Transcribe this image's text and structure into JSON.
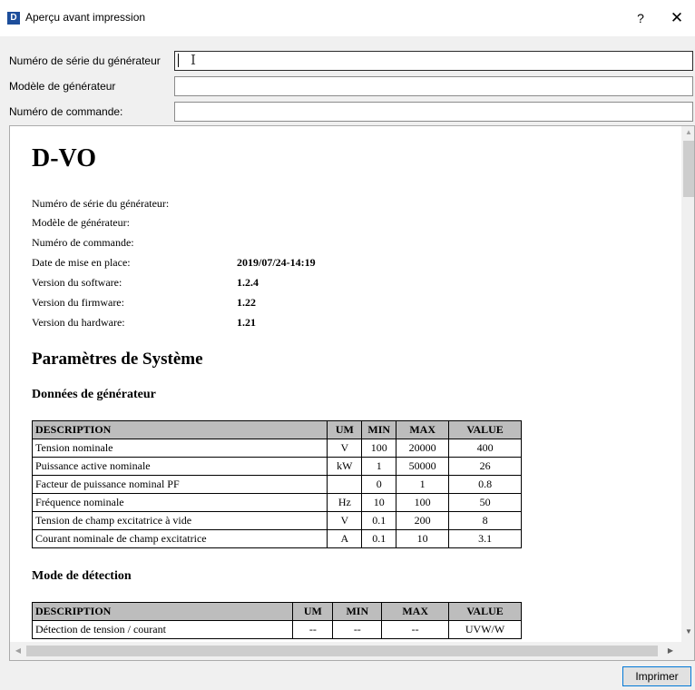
{
  "window": {
    "app_icon": "D",
    "title": "Aperçu avant impression",
    "help": "?",
    "close": "✕"
  },
  "form": {
    "fields": [
      {
        "label": "Numéro de série du générateur",
        "value": ""
      },
      {
        "label": "Modèle de générateur",
        "value": ""
      },
      {
        "label": "Numéro de commande:",
        "value": ""
      }
    ]
  },
  "document": {
    "title": "D-VO",
    "info": [
      {
        "label": "Numéro de série du générateur:",
        "value": ""
      },
      {
        "label": "Modèle de générateur:",
        "value": ""
      },
      {
        "label": "Numéro de commande:",
        "value": ""
      },
      {
        "label": "Date de mise en place:",
        "value": "2019/07/24-14:19"
      },
      {
        "label": "Version du software:",
        "value": "1.2.4"
      },
      {
        "label": "Version du firmware:",
        "value": "1.22"
      },
      {
        "label": "Version du hardware:",
        "value": "1.21"
      }
    ],
    "section_title": "Paramètres de Système",
    "generator": {
      "title": "Données de générateur",
      "headers": [
        "DESCRIPTION",
        "UM",
        "MIN",
        "MAX",
        "VALUE"
      ],
      "rows": [
        [
          "Tension nominale",
          "V",
          "100",
          "20000",
          "400"
        ],
        [
          "Puissance active nominale",
          "kW",
          "1",
          "50000",
          "26"
        ],
        [
          "Facteur de puissance nominal PF",
          "",
          "0",
          "1",
          "0.8"
        ],
        [
          "Fréquence nominale",
          "Hz",
          "10",
          "100",
          "50"
        ],
        [
          "Tension de champ excitatrice à vide",
          "V",
          "0.1",
          "200",
          "8"
        ],
        [
          "Courant nominale de champ excitatrice",
          "A",
          "0.1",
          "10",
          "3.1"
        ]
      ]
    },
    "detection": {
      "title": "Mode de détection",
      "headers": [
        "DESCRIPTION",
        "UM",
        "MIN",
        "MAX",
        "VALUE"
      ],
      "rows": [
        [
          "Détection de tension / courant",
          "--",
          "--",
          "--",
          "UVW/W"
        ]
      ]
    }
  },
  "scrollbars": {
    "up": "▲",
    "down": "▼",
    "left": "◀",
    "right": "▶"
  },
  "buttons": {
    "print": "Imprimer"
  },
  "colors": {
    "app_icon_bg": "#1d4e9b",
    "table_header_bg": "#bdbdbd",
    "button_focus_border": "#0078d7"
  }
}
